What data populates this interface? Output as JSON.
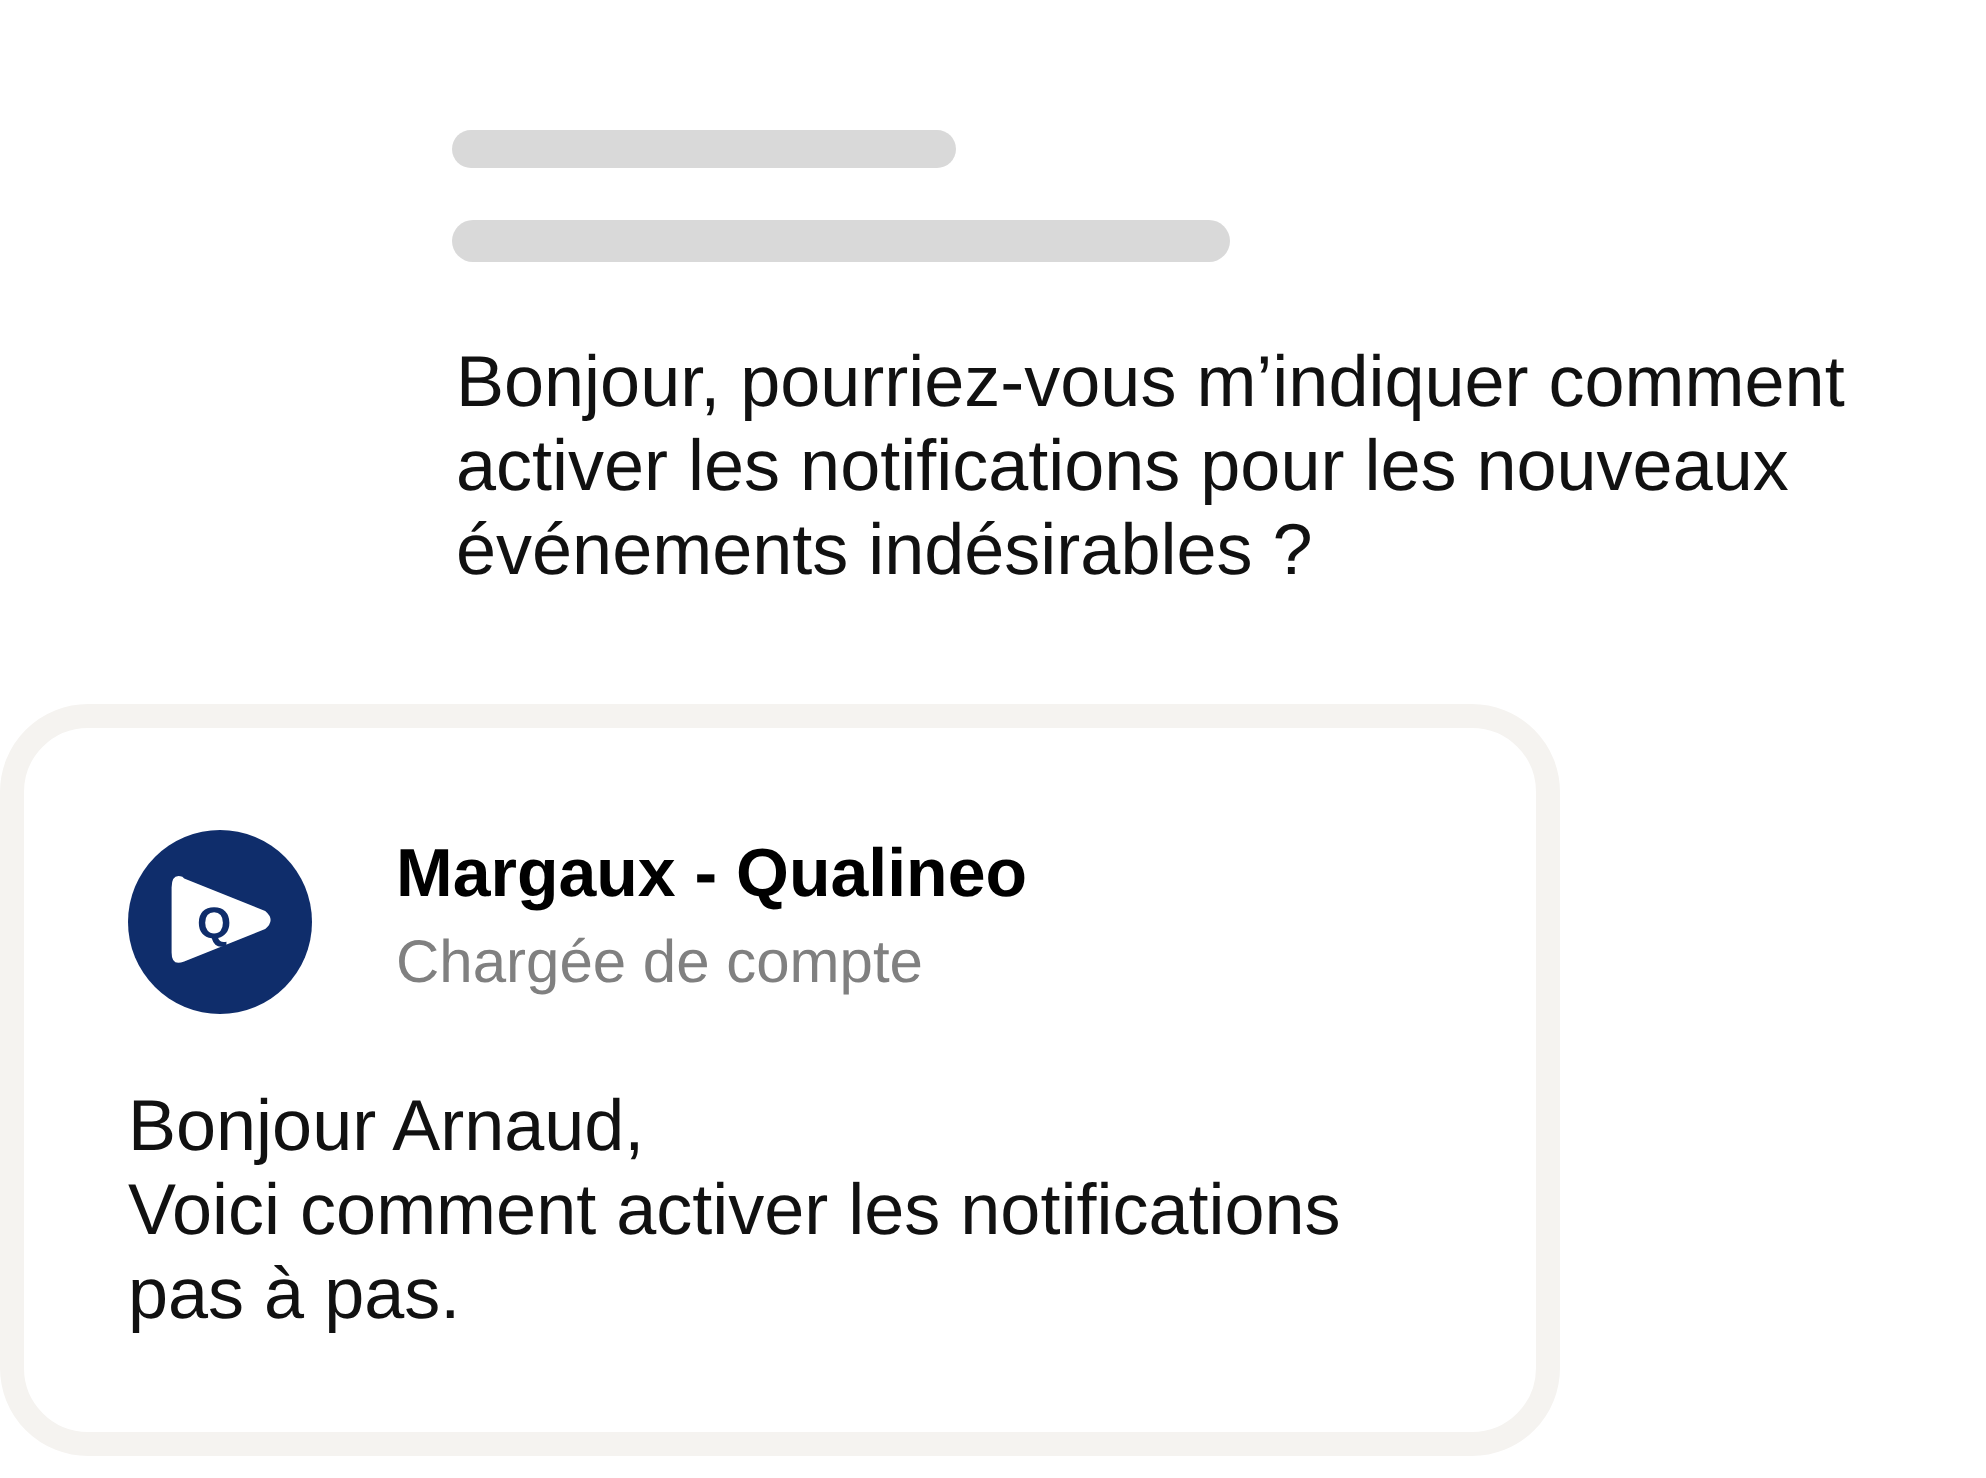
{
  "incoming_message": {
    "text": "Bonjour, pourriez-vous m’indiquer comment activer les notifications pour les nouveaux événements indésirables ?"
  },
  "reply_card": {
    "logo_letter": "Q",
    "sender_name": "Margaux - Qualineo",
    "sender_role": "Chargée de compte",
    "message_lines": [
      "Bonjour Arnaud,",
      "Voici comment activer les notifications pas à pas."
    ]
  }
}
